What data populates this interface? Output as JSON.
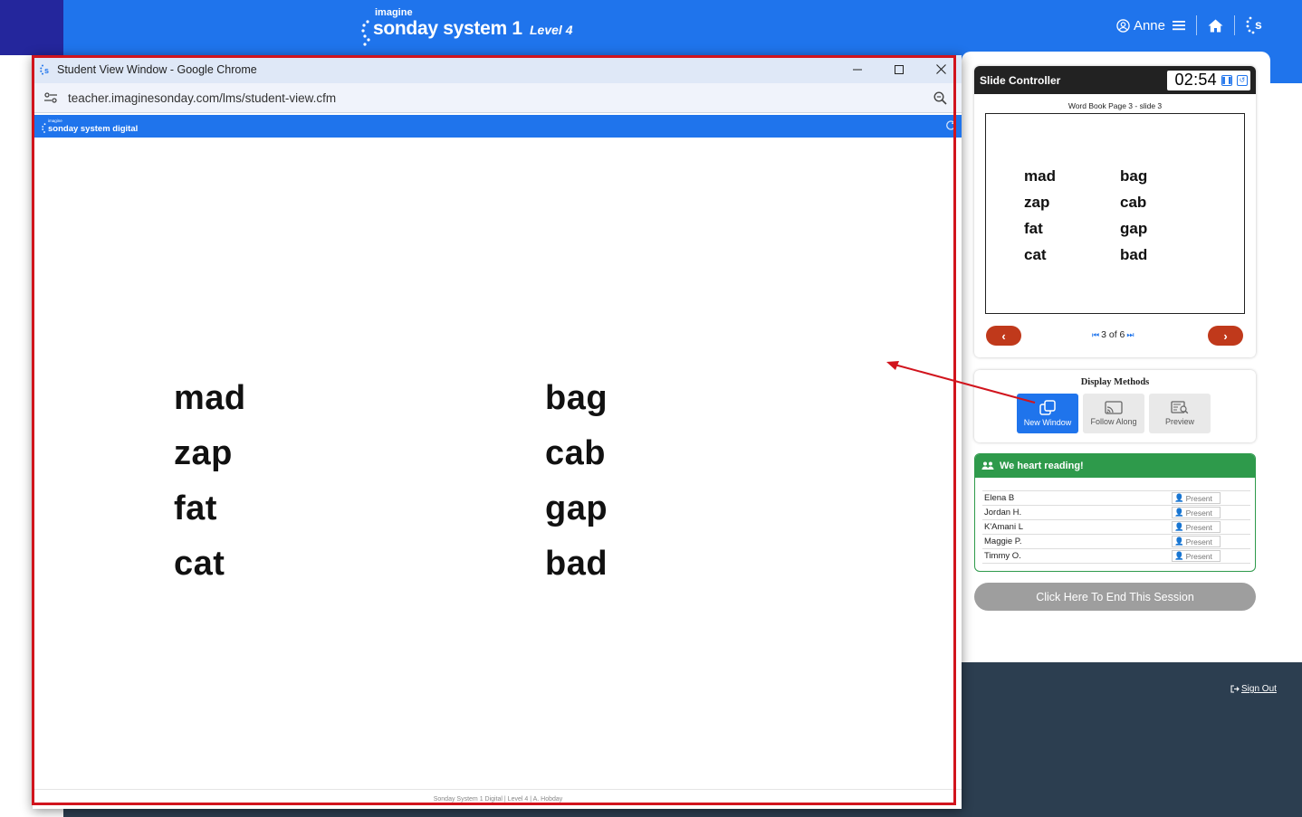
{
  "app": {
    "logo_small": "imagine",
    "logo_main": "sonday system 1",
    "level": "Level 4",
    "user_name": "Anne",
    "sign_out": "Sign Out",
    "colors": {
      "header": "#1f74ec",
      "left_strip": "#24269c",
      "footer_bg": "#2c3e50"
    }
  },
  "slide_controller": {
    "title": "Slide Controller",
    "timer": "02:54",
    "subtitle": "Word Book Page 3 - slide 3",
    "preview_words_left": [
      "mad",
      "zap",
      "fat",
      "cat"
    ],
    "preview_words_right": [
      "bag",
      "cab",
      "gap",
      "bad"
    ],
    "page_indicator": "3 of 6",
    "colors": {
      "nav_button": "#c0391b"
    }
  },
  "display_methods": {
    "title": "Display Methods",
    "options": [
      {
        "label": "New Window",
        "icon": "new-window-icon",
        "active": true
      },
      {
        "label": "Follow Along",
        "icon": "cast-icon",
        "active": false
      },
      {
        "label": "Preview",
        "icon": "preview-icon",
        "active": false
      }
    ]
  },
  "class_list": {
    "title": "We heart reading!",
    "students": [
      {
        "name": "Elena B",
        "status": "Present"
      },
      {
        "name": "Jordan H.",
        "status": "Present"
      },
      {
        "name": "K'Amani L",
        "status": "Present"
      },
      {
        "name": "Maggie P.",
        "status": "Present"
      },
      {
        "name": "Timmy O.",
        "status": "Present"
      }
    ],
    "colors": {
      "header": "#2e9a4b"
    }
  },
  "end_session_label": "Click Here To End This Session",
  "student_window": {
    "title": "Student View Window - Google Chrome",
    "url": "teacher.imaginesonday.com/lms/student-view.cfm",
    "inner_logo_small": "imagine",
    "inner_logo_main": "sonday system digital",
    "words_left": [
      "mad",
      "zap",
      "fat",
      "cat"
    ],
    "words_right": [
      "bag",
      "cab",
      "gap",
      "bad"
    ],
    "footer": "Sonday System 1 Digital | Level 4 | A. Hobday"
  },
  "annotation": {
    "highlight_color": "#d1141d"
  }
}
